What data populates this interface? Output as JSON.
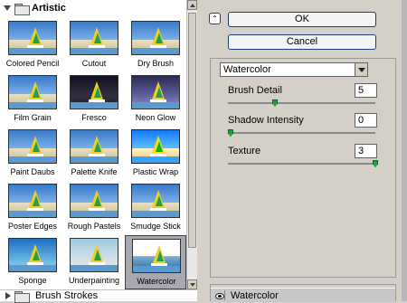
{
  "gallery": {
    "category": "Artistic",
    "footer_category": "Brush Strokes",
    "filters": [
      {
        "label": "Colored Pencil",
        "style": "normal"
      },
      {
        "label": "Cutout",
        "style": "normal"
      },
      {
        "label": "Dry Brush",
        "style": "normal"
      },
      {
        "label": "Film Grain",
        "style": "normal"
      },
      {
        "label": "Fresco",
        "style": "dark"
      },
      {
        "label": "Neon Glow",
        "style": "glow"
      },
      {
        "label": "Paint Daubs",
        "style": "normal"
      },
      {
        "label": "Palette Knife",
        "style": "normal"
      },
      {
        "label": "Plastic Wrap",
        "style": "wrap"
      },
      {
        "label": "Poster Edges",
        "style": "normal"
      },
      {
        "label": "Rough Pastels",
        "style": "normal"
      },
      {
        "label": "Smudge Stick",
        "style": "normal"
      },
      {
        "label": "Sponge",
        "style": "sponge"
      },
      {
        "label": "Underpainting",
        "style": "under"
      },
      {
        "label": "Watercolor",
        "style": "water",
        "selected": true
      }
    ]
  },
  "buttons": {
    "ok": "OK",
    "cancel": "Cancel"
  },
  "settings": {
    "filter_select": "Watercolor",
    "sliders": [
      {
        "label": "Brush Detail",
        "value": "5",
        "min": 1,
        "max": 14
      },
      {
        "label": "Shadow Intensity",
        "value": "0",
        "min": 0,
        "max": 10
      },
      {
        "label": "Texture",
        "value": "3",
        "min": 1,
        "max": 3
      }
    ]
  },
  "layers": {
    "items": [
      "Watercolor"
    ]
  },
  "icons": {
    "collapse": "double-chevron-up-icon",
    "eye": "eye-icon",
    "folder": "folder-icon"
  }
}
